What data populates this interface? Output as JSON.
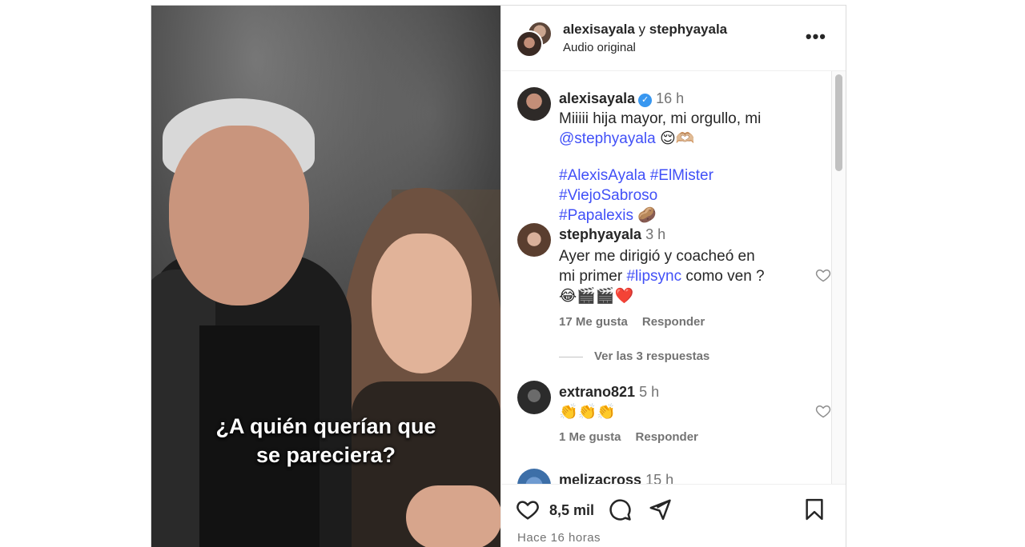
{
  "post": {
    "caption_overlay_line1": "¿A quién querían que",
    "caption_overlay_line2": "se pareciera?"
  },
  "header": {
    "user1": "alexisayala",
    "joiner": "y",
    "user2": "stephyayala",
    "audio": "Audio original",
    "more_icon": "more-horizontal-icon"
  },
  "comments": [
    {
      "user": "alexisayala",
      "verified": true,
      "time": "16 h",
      "text1": "Miiiii hija mayor, mi orgullo, mi",
      "mention": "@stephyayala",
      "emojis1": "😌🫶🏼",
      "hashtags": "#AlexisAyala #ElMister #ViejoSabroso",
      "hashtag2": "#Papalexis",
      "emoji2": "🥔"
    },
    {
      "user": "stephyayala",
      "time": "3 h",
      "text1": "Ayer me dirigió y coacheó en",
      "text2a": "mi primer",
      "hashtag": "#lipsync",
      "text2b": "como ven ?",
      "emojis": "😂🎬🎬❤️",
      "likes": "17 Me gusta",
      "reply": "Responder",
      "view_replies": "Ver las 3 respuestas"
    },
    {
      "user": "extrano821",
      "time": "5 h",
      "emojis": "👏👏👏",
      "likes": "1 Me gusta",
      "reply": "Responder"
    },
    {
      "user": "melizacross",
      "time": "15 h"
    }
  ],
  "footer": {
    "likes": "8,5 mil",
    "ago": "Hace 16 horas",
    "icons": [
      "heart-icon",
      "comment-icon",
      "share-icon",
      "bookmark-icon"
    ]
  },
  "colors": {
    "link": "#4150f7",
    "verified": "#3897f0",
    "muted": "#737373"
  }
}
